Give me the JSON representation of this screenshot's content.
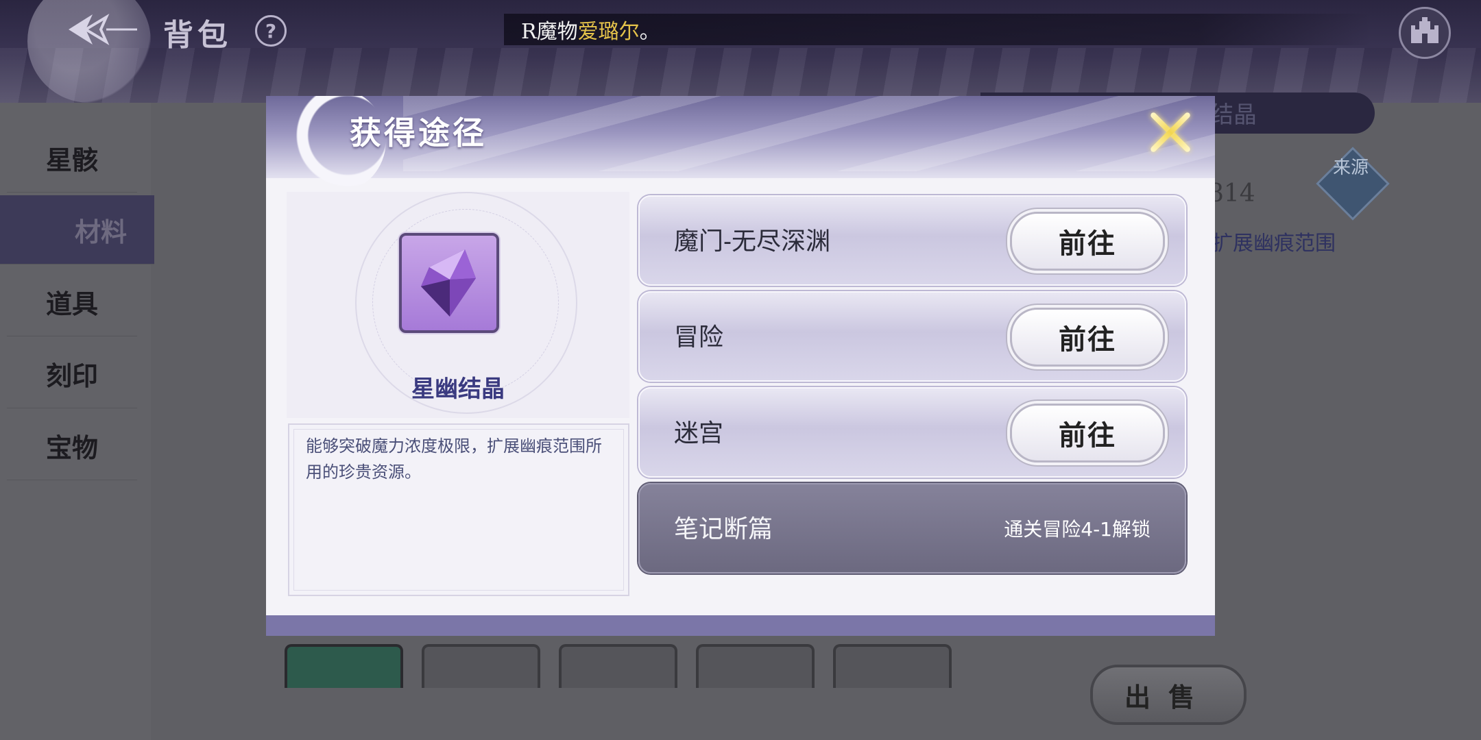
{
  "topbar": {
    "title": "背包",
    "help_icon": "help-icon",
    "back_icon": "back-arrow-icon",
    "marquee": {
      "part1": "R魔物",
      "part2": "爱璐尔",
      "part3": "。"
    },
    "home_icon": "castle-icon"
  },
  "sidebar": {
    "items": [
      {
        "label": "星骸"
      },
      {
        "label": "材料"
      },
      {
        "label": "道具"
      },
      {
        "label": "刻印"
      },
      {
        "label": "宝物"
      }
    ],
    "active_index": 1
  },
  "background": {
    "panel_text": "结晶",
    "count": "814",
    "desc": "扩展幽痕范围",
    "source_label": "来源",
    "sell_label": "出售"
  },
  "modal": {
    "title": "获得途径",
    "close_icon": "close-x-icon",
    "item": {
      "name": "星幽结晶",
      "icon": "purple-crystal-icon",
      "description": "能够突破魔力浓度极限，扩展幽痕范围所用的珍贵资源。"
    },
    "sources": [
      {
        "label": "魔门-无尽深渊",
        "action": "前往",
        "locked": false
      },
      {
        "label": "冒险",
        "action": "前往",
        "locked": false
      },
      {
        "label": "迷宫",
        "action": "前往",
        "locked": false
      },
      {
        "label": "笔记断篇",
        "locked": true,
        "lock_text": "通关冒险4-1解锁"
      }
    ]
  },
  "colors": {
    "accent": "#3d3a58",
    "title_gold": "#e5c34a",
    "locked_row": "#6c6980"
  }
}
